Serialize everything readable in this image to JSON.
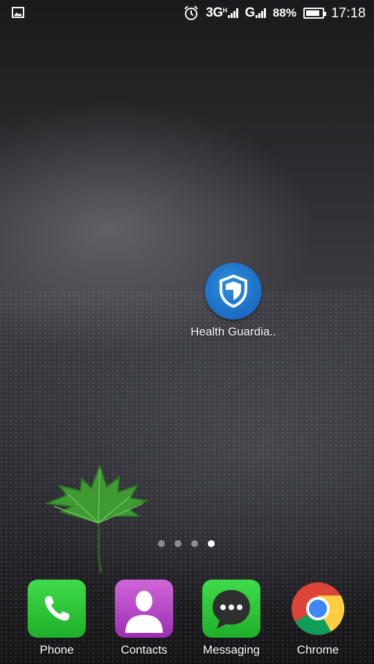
{
  "status_bar": {
    "notification_icon": "image-icon",
    "alarm_icon": "alarm-clock-icon",
    "network_1": "3G",
    "network_1_sub": "H",
    "network_2": "G",
    "battery_percent": "88%",
    "battery_level": 0.88,
    "time": "17:18"
  },
  "home": {
    "apps": [
      {
        "label": "Health Guardia..",
        "icon": "shield-icon",
        "color": "#1a6cc2"
      }
    ],
    "page_indicator": {
      "count": 4,
      "active_index": 3
    }
  },
  "dock": [
    {
      "label": "Phone",
      "icon": "phone-icon",
      "color": "#2cc236"
    },
    {
      "label": "Contacts",
      "icon": "person-icon",
      "color": "#b544c4"
    },
    {
      "label": "Messaging",
      "icon": "chat-bubble-icon",
      "color": "#2cc236"
    },
    {
      "label": "Chrome",
      "icon": "chrome-icon",
      "color": "#db4437"
    }
  ]
}
